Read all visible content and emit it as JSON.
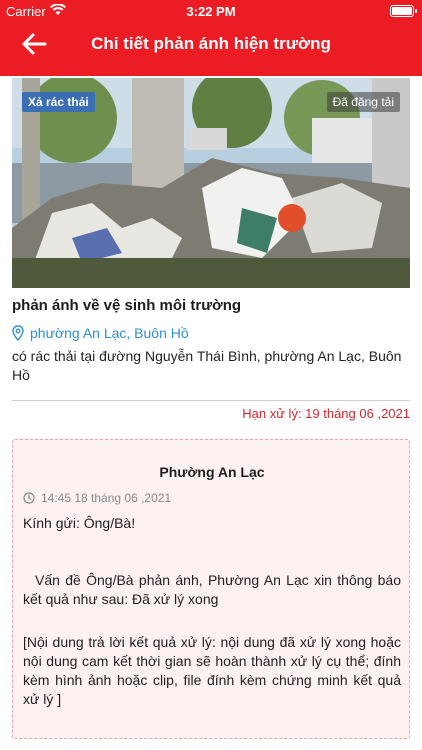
{
  "status_bar": {
    "carrier": "Carrier",
    "time": "3:22 PM"
  },
  "header": {
    "title": "Chi tiết phản ánh hiện trường",
    "back_icon": "arrow-left-icon",
    "background": "#ec1c24"
  },
  "report": {
    "category_badge": "Xả rác thải",
    "status_badge": "Đã đăng tải",
    "title": "phản ánh về vệ sinh môi trường",
    "location": "phường An Lạc, Buôn Hồ",
    "description": "có rác thải tại đường Nguyễn Thái Bình, phường An Lạc, Buôn Hồ",
    "deadline": "Hạn xử lý: 19 tháng 06 ,2021"
  },
  "reply": {
    "organization": "Phường An Lạc",
    "time": "14:45 18 tháng 06 ,2021",
    "greeting": "Kính gửi: Ông/Bà!",
    "paragraph_1": "Vấn đề Ông/Bà phản ánh, Phường An Lạc xin thông báo kết quả như sau: Đã xử lý xong",
    "paragraph_2": "[Nội dung trả lời kết quả xử lý: nội dung đã xử lý xong hoặc nội dung cam kết thời gian sẽ hoàn thành xử lý cụ thể; đính kèm hình ảnh hoặc clip, file đính kèm chứng minh kết quả xử lý ]"
  },
  "colors": {
    "accent": "#ec1c24",
    "link": "#2f8fd6",
    "deadline": "#d6262e",
    "card_bg": "#fdf1f1"
  }
}
